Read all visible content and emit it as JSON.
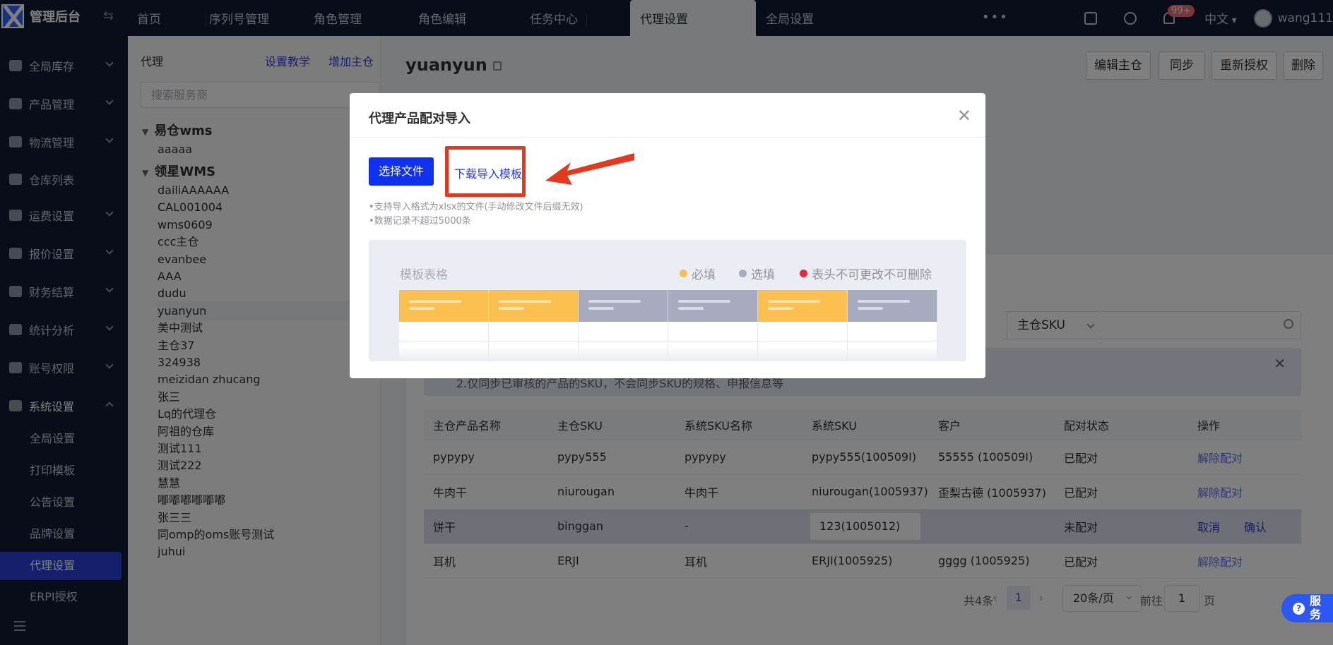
{
  "app": {
    "title": "管理后台"
  },
  "tabs": [
    "首页",
    "序列号管理",
    "角色管理",
    "角色编辑",
    "任务中心",
    "代理设置",
    "全局设置"
  ],
  "active_tab": "代理设置",
  "topbar": {
    "badge": "99+",
    "language": "中文",
    "user": "wang111"
  },
  "sidebar": {
    "items": [
      {
        "label": "全局库存",
        "icon": "warehouse-icon"
      },
      {
        "label": "产品管理",
        "icon": "bag-icon"
      },
      {
        "label": "物流管理",
        "icon": "truck-icon"
      },
      {
        "label": "仓库列表",
        "icon": "depot-icon"
      },
      {
        "label": "运费设置",
        "icon": "boxes-icon"
      },
      {
        "label": "报价设置",
        "icon": "document-icon"
      },
      {
        "label": "财务结算",
        "icon": "dollar-icon"
      },
      {
        "label": "统计分析",
        "icon": "chart-icon"
      },
      {
        "label": "账号权限",
        "icon": "org-icon"
      },
      {
        "label": "系统设置",
        "icon": "gear-icon"
      }
    ],
    "sub_items": [
      "全局设置",
      "打印模板",
      "公告设置",
      "品牌设置",
      "代理设置",
      "ERPI授权"
    ],
    "active_sub": "代理设置"
  },
  "tree": {
    "title": "代理",
    "link_tutorial": "设置教学",
    "link_add": "增加主仓",
    "search_placeholder": "搜索服务商",
    "group1": "易仓wms",
    "group1_items": [
      "aaaaa"
    ],
    "group2": "领星WMS",
    "group2_items": [
      "dailiAAAAAA",
      "CAL001004",
      "wms0609",
      "ccc主仓",
      "evanbee",
      "AAA",
      "dudu",
      "yuanyun",
      "美中测试",
      "主仓37",
      "324938",
      "meizidan zhucang",
      "张三",
      "Lq的代理仓",
      "阿祖的仓库",
      "测试111",
      "测试222",
      "慧慧",
      "嘟嘟嘟嘟嘟嘟",
      "张三三",
      "同omp的oms账号测试",
      "juhui"
    ],
    "selected": "yuanyun"
  },
  "main": {
    "title": "yuanyun",
    "buttons": [
      "编辑主仓",
      "同步",
      "重新授权",
      "删除"
    ],
    "filter_select": "主仓SKU",
    "alert_text": "2.仅同步已审核的产品的SKU，不会同步SKU的规格、申报信息等",
    "table": {
      "headers": [
        "主仓产品名称",
        "主仓SKU",
        "系统SKU名称",
        "系统SKU",
        "客户",
        "配对状态",
        "操作"
      ],
      "rows": [
        [
          "pypypy",
          "pypy555",
          "pypypy",
          "pypy555(100509I)",
          "55555 (100509I)",
          "已配对",
          "解除配对"
        ],
        [
          "牛肉干",
          "niurougan",
          "牛肉干",
          "niurougan(1005937)",
          "歪梨古德 (1005937)",
          "已配对",
          "解除配对"
        ],
        [
          "饼干",
          "binggan",
          "-",
          "123(1005012)",
          "",
          "未配对",
          "取消",
          "确认"
        ],
        [
          "耳机",
          "ERJI",
          "耳机",
          "ERJI(1005925)",
          "gggg (1005925)",
          "已配对",
          "解除配对"
        ]
      ]
    },
    "pager": {
      "total": "共4条",
      "page": "1",
      "size": "20条/页",
      "goto": "前往",
      "goto_value": "1",
      "trail": "页"
    }
  },
  "modal": {
    "title": "代理产品配对导入",
    "choose_button": "选择文件",
    "download_link": "下载导入模板",
    "hint1": "•支持导入格式为xlsx的文件(手动修改文件后缀无效)",
    "hint2": "•数据记录不超过5000条",
    "template_label": "模板表格",
    "legend": [
      {
        "label": "必填",
        "color": "#fbc04f"
      },
      {
        "label": "选填",
        "color": "#a8abbf"
      },
      {
        "label": "表头不可更改不可删除",
        "color": "#e8293d"
      }
    ],
    "template_columns": [
      "required",
      "required",
      "optional",
      "optional",
      "required",
      "optional"
    ]
  },
  "colors": {
    "accent": "#2b3ed8",
    "annotation": "#e2391f",
    "required": "#fbc04f",
    "optional": "#a8abbf"
  },
  "service": {
    "label": "服务"
  }
}
